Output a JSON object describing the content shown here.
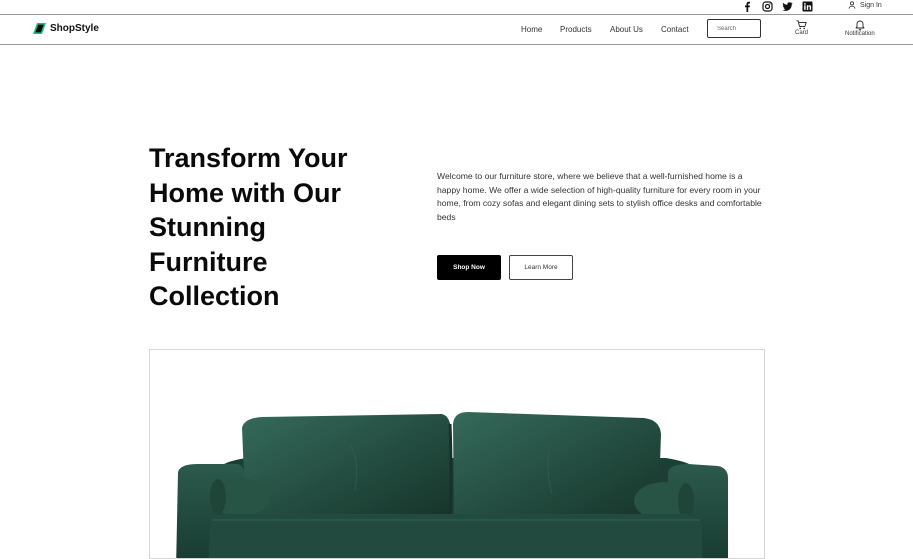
{
  "topbar": {
    "social": [
      "facebook-icon",
      "instagram-icon",
      "twitter-icon",
      "linkedin-icon"
    ],
    "signin_label": "Sign In"
  },
  "brand": {
    "name": "ShopStyle",
    "logo_colors": [
      "#10c27a",
      "#0a0a0a"
    ]
  },
  "nav": {
    "links": [
      "Home",
      "Products",
      "About Us",
      "Contact"
    ],
    "search_placeholder": "Search",
    "cart_label": "Card",
    "notification_label": "Notification"
  },
  "hero": {
    "title_lines": [
      "Transform Your",
      "Home with Our",
      "Stunning",
      "Furniture",
      "Collection"
    ],
    "description": "Welcome to our furniture store, where we believe that a well-furnished home is a happy home. We offer a wide selection of high-quality furniture for every room in your home, from cozy sofas and elegant dining sets to stylish office desks and comfortable beds",
    "primary_button": "Shop Now",
    "secondary_button": "Learn More"
  },
  "product_image": {
    "subject": "sofa-image",
    "color": "#1f4a3e"
  }
}
